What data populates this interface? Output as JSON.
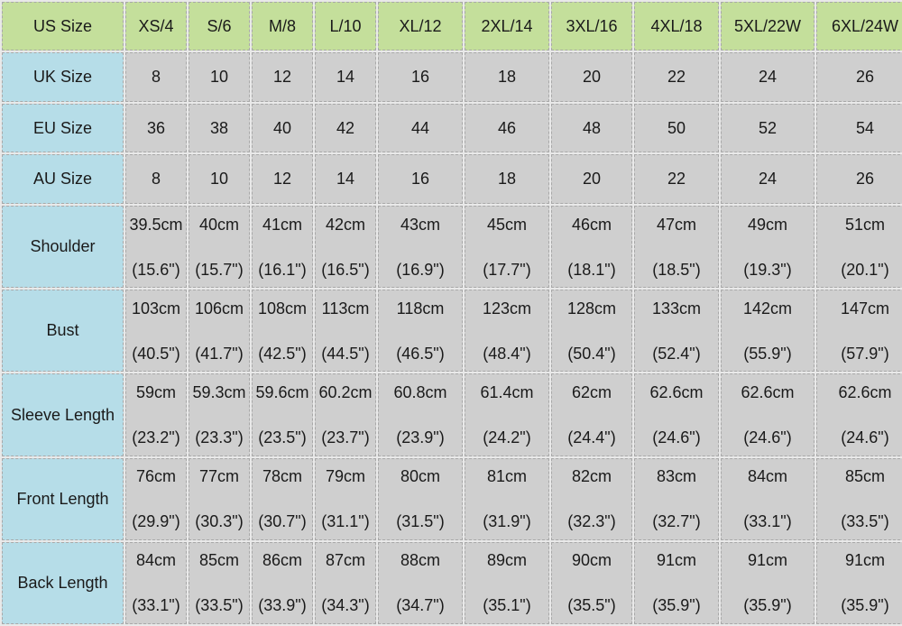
{
  "table": {
    "header": {
      "label": "US Size",
      "sizes": [
        "XS/4",
        "S/6",
        "M/8",
        "L/10",
        "XL/12",
        "2XL/14",
        "3XL/16",
        "4XL/18",
        "5XL/22W",
        "6XL/24W"
      ]
    },
    "simple_rows": [
      {
        "label": "UK Size",
        "values": [
          "8",
          "10",
          "12",
          "14",
          "16",
          "18",
          "20",
          "22",
          "24",
          "26"
        ]
      },
      {
        "label": "EU Size",
        "values": [
          "36",
          "38",
          "40",
          "42",
          "44",
          "46",
          "48",
          "50",
          "52",
          "54"
        ]
      },
      {
        "label": "AU Size",
        "values": [
          "8",
          "10",
          "12",
          "14",
          "16",
          "18",
          "20",
          "22",
          "24",
          "26"
        ]
      }
    ],
    "measure_rows": [
      {
        "label": "Shoulder",
        "cm": [
          "39.5cm",
          "40cm",
          "41cm",
          "42cm",
          "43cm",
          "45cm",
          "46cm",
          "47cm",
          "49cm",
          "51cm"
        ],
        "inch": [
          "(15.6\")",
          "(15.7\")",
          "(16.1\")",
          "(16.5\")",
          "(16.9\")",
          "(17.7\")",
          "(18.1\")",
          "(18.5\")",
          "(19.3\")",
          "(20.1\")"
        ]
      },
      {
        "label": "Bust",
        "cm": [
          "103cm",
          "106cm",
          "108cm",
          "113cm",
          "118cm",
          "123cm",
          "128cm",
          "133cm",
          "142cm",
          "147cm"
        ],
        "inch": [
          "(40.5\")",
          "(41.7\")",
          "(42.5\")",
          "(44.5\")",
          "(46.5\")",
          "(48.4\")",
          "(50.4\")",
          "(52.4\")",
          "(55.9\")",
          "(57.9\")"
        ]
      },
      {
        "label": "Sleeve Length",
        "cm": [
          "59cm",
          "59.3cm",
          "59.6cm",
          "60.2cm",
          "60.8cm",
          "61.4cm",
          "62cm",
          "62.6cm",
          "62.6cm",
          "62.6cm"
        ],
        "inch": [
          "(23.2\")",
          "(23.3\")",
          "(23.5\")",
          "(23.7\")",
          "(23.9\")",
          "(24.2\")",
          "(24.4\")",
          "(24.6\")",
          "(24.6\")",
          "(24.6\")"
        ]
      },
      {
        "label": "Front Length",
        "cm": [
          "76cm",
          "77cm",
          "78cm",
          "79cm",
          "80cm",
          "81cm",
          "82cm",
          "83cm",
          "84cm",
          "85cm"
        ],
        "inch": [
          "(29.9\")",
          "(30.3\")",
          "(30.7\")",
          "(31.1\")",
          "(31.5\")",
          "(31.9\")",
          "(32.3\")",
          "(32.7\")",
          "(33.1\")",
          "(33.5\")"
        ]
      },
      {
        "label": "Back Length",
        "cm": [
          "84cm",
          "85cm",
          "86cm",
          "87cm",
          "88cm",
          "89cm",
          "90cm",
          "91cm",
          "91cm",
          "91cm"
        ],
        "inch": [
          "(33.1\")",
          "(33.5\")",
          "(33.9\")",
          "(34.3\")",
          "(34.7\")",
          "(35.1\")",
          "(35.5\")",
          "(35.9\")",
          "(35.9\")",
          "(35.9\")"
        ]
      }
    ]
  }
}
